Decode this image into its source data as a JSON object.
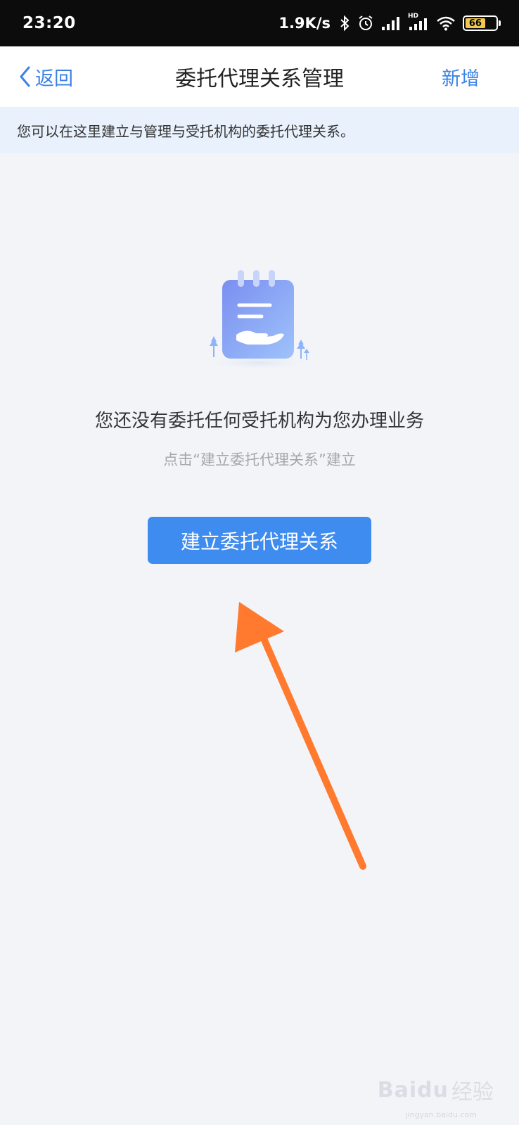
{
  "status_bar": {
    "time": "23:20",
    "net_speed": "1.9K/s",
    "battery_level": "66",
    "hd_label": "HD"
  },
  "nav": {
    "back_label": "返回",
    "title": "委托代理关系管理",
    "action_label": "新增"
  },
  "notice": {
    "text": "您可以在这里建立与管理与受托机构的委托代理关系。"
  },
  "empty_state": {
    "title": "您还没有委托任何受托机构为您办理业务",
    "hint": "点击“建立委托代理关系”建立",
    "button_label": "建立委托代理关系"
  },
  "watermark": {
    "brand": "Baidu",
    "label": "经验",
    "url": "jingyan.baidu.com"
  },
  "colors": {
    "accent": "#3f8cf0",
    "annotation_arrow": "#ff7a2e",
    "notice_bg": "#e8f1fc",
    "page_bg": "#f2f4f8"
  }
}
